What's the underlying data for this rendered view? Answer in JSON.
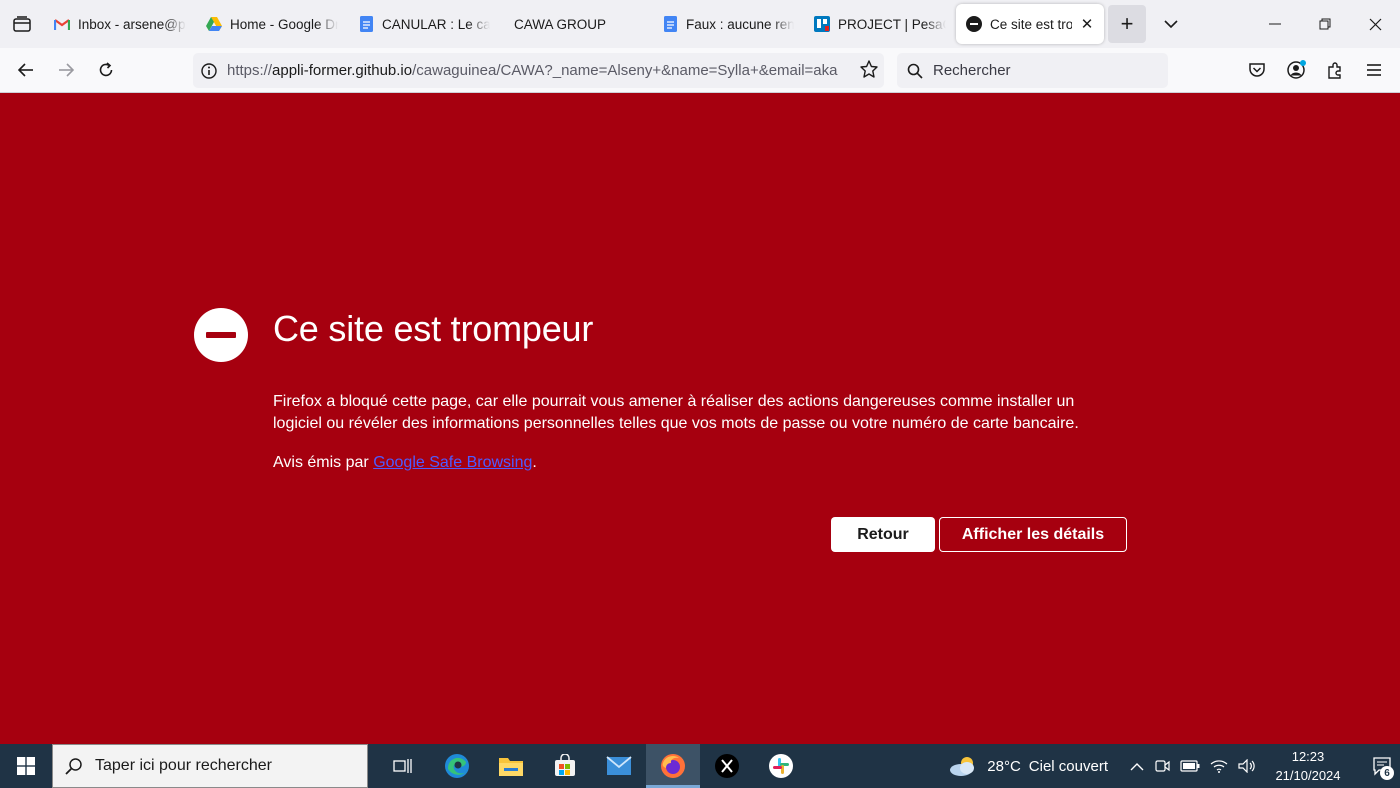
{
  "browser": {
    "tabs": [
      {
        "title": "Inbox - arsene@pesacheck",
        "icon": "gmail-icon",
        "active": false
      },
      {
        "title": "Home - Google Drive",
        "icon": "google-drive-icon",
        "active": false
      },
      {
        "title": "CANULAR : Le cabinet",
        "icon": "google-docs-icon",
        "active": false
      },
      {
        "title": "CAWA GROUP",
        "icon": "blank-icon",
        "active": false
      },
      {
        "title": "Faux : aucune rencontre",
        "icon": "google-docs-icon",
        "active": false
      },
      {
        "title": "PROJECT | PesaCheck",
        "icon": "trello-icon",
        "active": false
      },
      {
        "title": "Ce site est trompeur",
        "icon": "blocked-icon",
        "active": true
      }
    ],
    "new_tab_label": "+",
    "url": {
      "prefix": "https://",
      "host": "appli-former.github.io",
      "path": "/cawaguinea/CAWA?_name=Alseny+&name=Sylla+&email=aka"
    },
    "search_placeholder": "Rechercher"
  },
  "error_page": {
    "title": "Ce site est trompeur",
    "description": "Firefox a bloqué cette page, car elle pourrait vous amener à réaliser des actions dangereuses comme installer un logiciel ou révéler des informations personnelles telles que vos mots de passe ou votre numéro de carte bancaire.",
    "advisory_prefix": "Avis émis par ",
    "advisory_link": "Google Safe Browsing",
    "advisory_suffix": ".",
    "back_button": "Retour",
    "details_button": "Afficher les détails",
    "background_color": "#a6000f",
    "link_color": "#4d5cff"
  },
  "taskbar": {
    "search_placeholder": "Taper ici pour rechercher",
    "apps": [
      "task-view-icon",
      "edge-icon",
      "file-explorer-icon",
      "microsoft-store-icon",
      "mail-icon",
      "firefox-icon",
      "x-icon",
      "slack-icon"
    ],
    "active_app": "firefox-icon",
    "weather_temp": "28°C",
    "weather_desc": "Ciel couvert",
    "time": "12:23",
    "date": "21/10/2024",
    "notification_count": "6"
  }
}
